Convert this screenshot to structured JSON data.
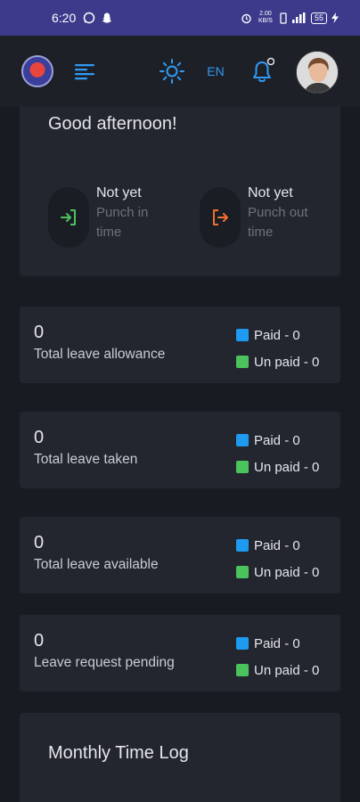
{
  "status_bar": {
    "time": "6:20",
    "network_speed": "2.00 KB/S",
    "battery": "55"
  },
  "header": {
    "language": "EN",
    "icons": {
      "logo": "app-logo",
      "menu": "menu-icon",
      "theme": "sun-icon",
      "notifications": "bell-icon",
      "avatar": "user-avatar"
    },
    "notification_dot": true
  },
  "greeting_card": {
    "greeting": "Good afternoon!",
    "punch_in": {
      "status": "Not yet",
      "label": "Punch in time",
      "icon": "login-icon",
      "color": "#4cc25d"
    },
    "punch_out": {
      "status": "Not yet",
      "label": "Punch out time",
      "icon": "logout-icon",
      "color": "#f0712f"
    }
  },
  "leave_cards": [
    {
      "value": "0",
      "label": "Total leave allowance",
      "paid": "Paid - 0",
      "unpaid": "Un paid - 0"
    },
    {
      "value": "0",
      "label": "Total leave taken",
      "paid": "Paid - 0",
      "unpaid": "Un paid - 0"
    },
    {
      "value": "0",
      "label": "Total leave available",
      "paid": "Paid - 0",
      "unpaid": "Un paid - 0"
    },
    {
      "value": "0",
      "label": "Leave request pending",
      "paid": "Paid - 0",
      "unpaid": "Un paid - 0"
    }
  ],
  "colors": {
    "accent_blue": "#1e9bf0",
    "paid": "#1e9bf0",
    "unpaid": "#4cc25d",
    "background": "#191b22",
    "card": "#23262f",
    "status_bar": "#3d3a8c"
  },
  "time_log": {
    "title": "Monthly Time Log"
  }
}
